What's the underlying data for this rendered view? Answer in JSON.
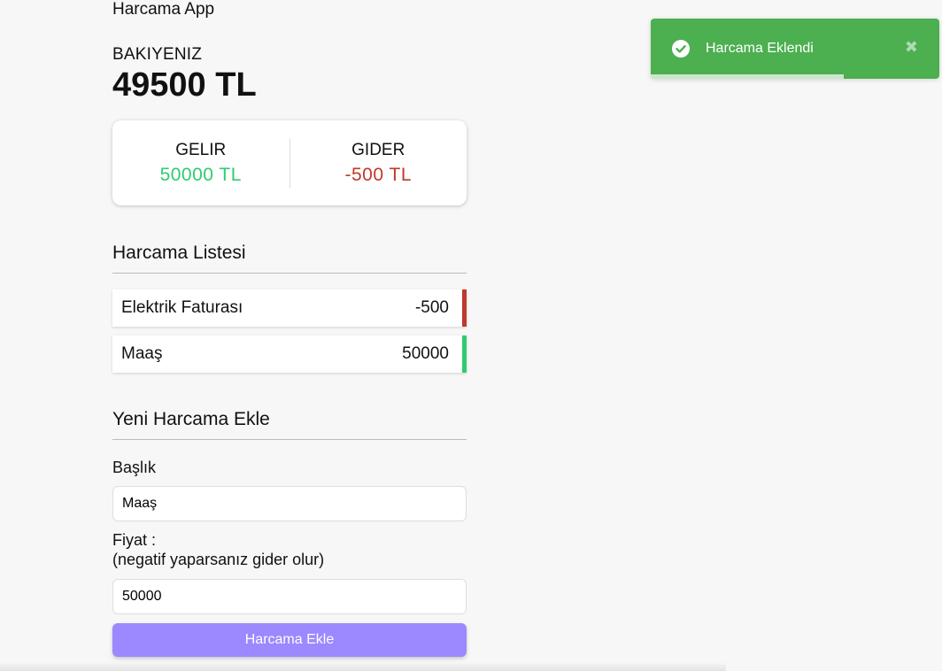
{
  "app": {
    "title": "Harcama App"
  },
  "balance": {
    "label": "BAKIYENIZ",
    "value": "49500 TL"
  },
  "summary": {
    "income_label": "GELIR",
    "income_value": "50000 TL",
    "expense_label": "GIDER",
    "expense_value": "-500 TL",
    "income_color": "#2ecc71",
    "expense_color": "#c0392b"
  },
  "list": {
    "title": "Harcama Listesi",
    "items": [
      {
        "title": "Elektrik Faturası",
        "amount": "-500",
        "type": "minus"
      },
      {
        "title": "Maaş",
        "amount": "50000",
        "type": "plus"
      }
    ]
  },
  "form": {
    "title": "Yeni Harcama Ekle",
    "title_label": "Başlık",
    "title_value": "Maaş",
    "price_label": "Fiyat :",
    "price_hint": "(negatif yaparsanız gider olur)",
    "price_value": "50000",
    "submit_label": "Harcama Ekle",
    "submit_color": "#9c88ff"
  },
  "toast": {
    "message": "Harcama Eklendi",
    "icon": "check-circle-icon",
    "close_icon": "close-icon",
    "color": "#4caf50",
    "progress_remaining": 0.67
  }
}
